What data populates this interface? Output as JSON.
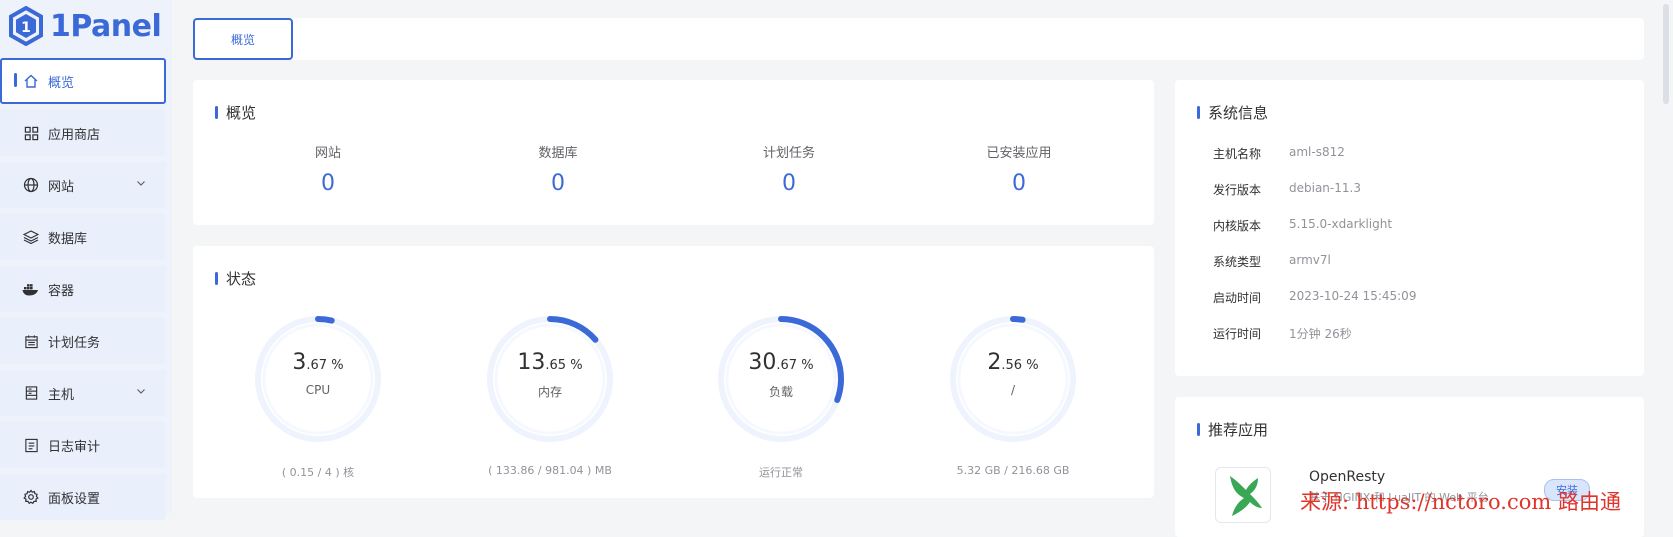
{
  "brand": {
    "name": "1Panel",
    "color": "#3b6ad8"
  },
  "sidebar": {
    "items": [
      {
        "label": "概览",
        "icon": "home-icon",
        "active": true
      },
      {
        "label": "应用商店",
        "icon": "grid-icon"
      },
      {
        "label": "网站",
        "icon": "globe-icon",
        "expandable": true
      },
      {
        "label": "数据库",
        "icon": "layers-icon"
      },
      {
        "label": "容器",
        "icon": "docker-icon"
      },
      {
        "label": "计划任务",
        "icon": "calendar-icon"
      },
      {
        "label": "主机",
        "icon": "server-icon",
        "expandable": true
      },
      {
        "label": "日志审计",
        "icon": "log-icon"
      },
      {
        "label": "面板设置",
        "icon": "gear-icon"
      }
    ]
  },
  "tabs": [
    {
      "label": "概览"
    }
  ],
  "overview": {
    "title": "概览",
    "stats": [
      {
        "label": "网站",
        "value": "0"
      },
      {
        "label": "数据库",
        "value": "0"
      },
      {
        "label": "计划任务",
        "value": "0"
      },
      {
        "label": "已安装应用",
        "value": "0"
      }
    ]
  },
  "status": {
    "title": "状态",
    "gauges": [
      {
        "int": "3",
        "dec": ".67 %",
        "name": "CPU",
        "footer": "( 0.15 / 4 ) 核",
        "percent": 3.67
      },
      {
        "int": "13",
        "dec": ".65 %",
        "name": "内存",
        "footer": "( 133.86 / 981.04 ) MB",
        "percent": 13.65
      },
      {
        "int": "30",
        "dec": ".67 %",
        "name": "负载",
        "footer": "运行正常",
        "percent": 30.67
      },
      {
        "int": "2",
        "dec": ".56 %",
        "name": "/",
        "footer": "5.32 GB / 216.68 GB",
        "percent": 2.56
      }
    ]
  },
  "sysinfo": {
    "title": "系统信息",
    "rows": [
      {
        "key": "主机名称",
        "value": "aml-s812"
      },
      {
        "key": "发行版本",
        "value": "debian-11.3"
      },
      {
        "key": "内核版本",
        "value": "5.15.0-xdarklight"
      },
      {
        "key": "系统类型",
        "value": "armv7l"
      },
      {
        "key": "启动时间",
        "value": "2023-10-24 15:45:09"
      },
      {
        "key": "运行时间",
        "value": "1分钟 26秒"
      }
    ]
  },
  "recommend": {
    "title": "推荐应用",
    "app": {
      "name": "OpenResty",
      "desc": "基于 NGINX 和 LuaJIT 的 Web 平台",
      "install_label": "安装"
    }
  },
  "watermark": "来源: https://nctoro.com 路由通"
}
